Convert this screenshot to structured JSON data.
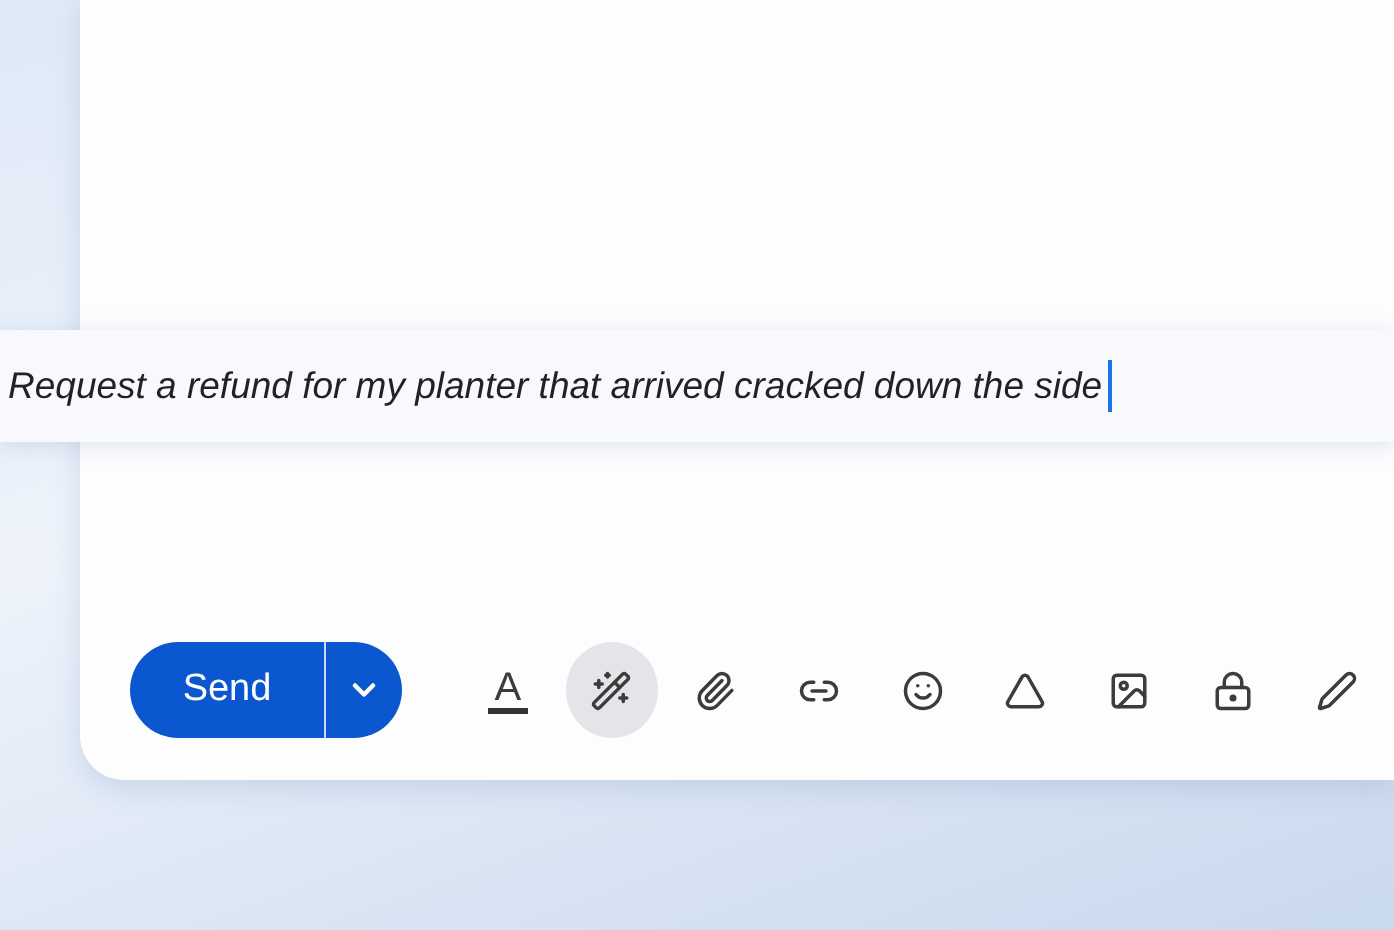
{
  "prompt": {
    "value": "Request a refund for my planter that arrived cracked down the side",
    "focused": true
  },
  "toolbar": {
    "send": {
      "label": "Send"
    },
    "tools": [
      {
        "kind": "format",
        "label": "A",
        "selected": false
      },
      {
        "kind": "write",
        "selected": true
      },
      {
        "kind": "attach",
        "selected": false
      },
      {
        "kind": "link",
        "selected": false
      },
      {
        "kind": "emoji",
        "selected": false
      },
      {
        "kind": "drive",
        "selected": false
      },
      {
        "kind": "photo",
        "selected": false
      },
      {
        "kind": "confidential",
        "selected": false
      },
      {
        "kind": "signature",
        "selected": false
      }
    ]
  }
}
